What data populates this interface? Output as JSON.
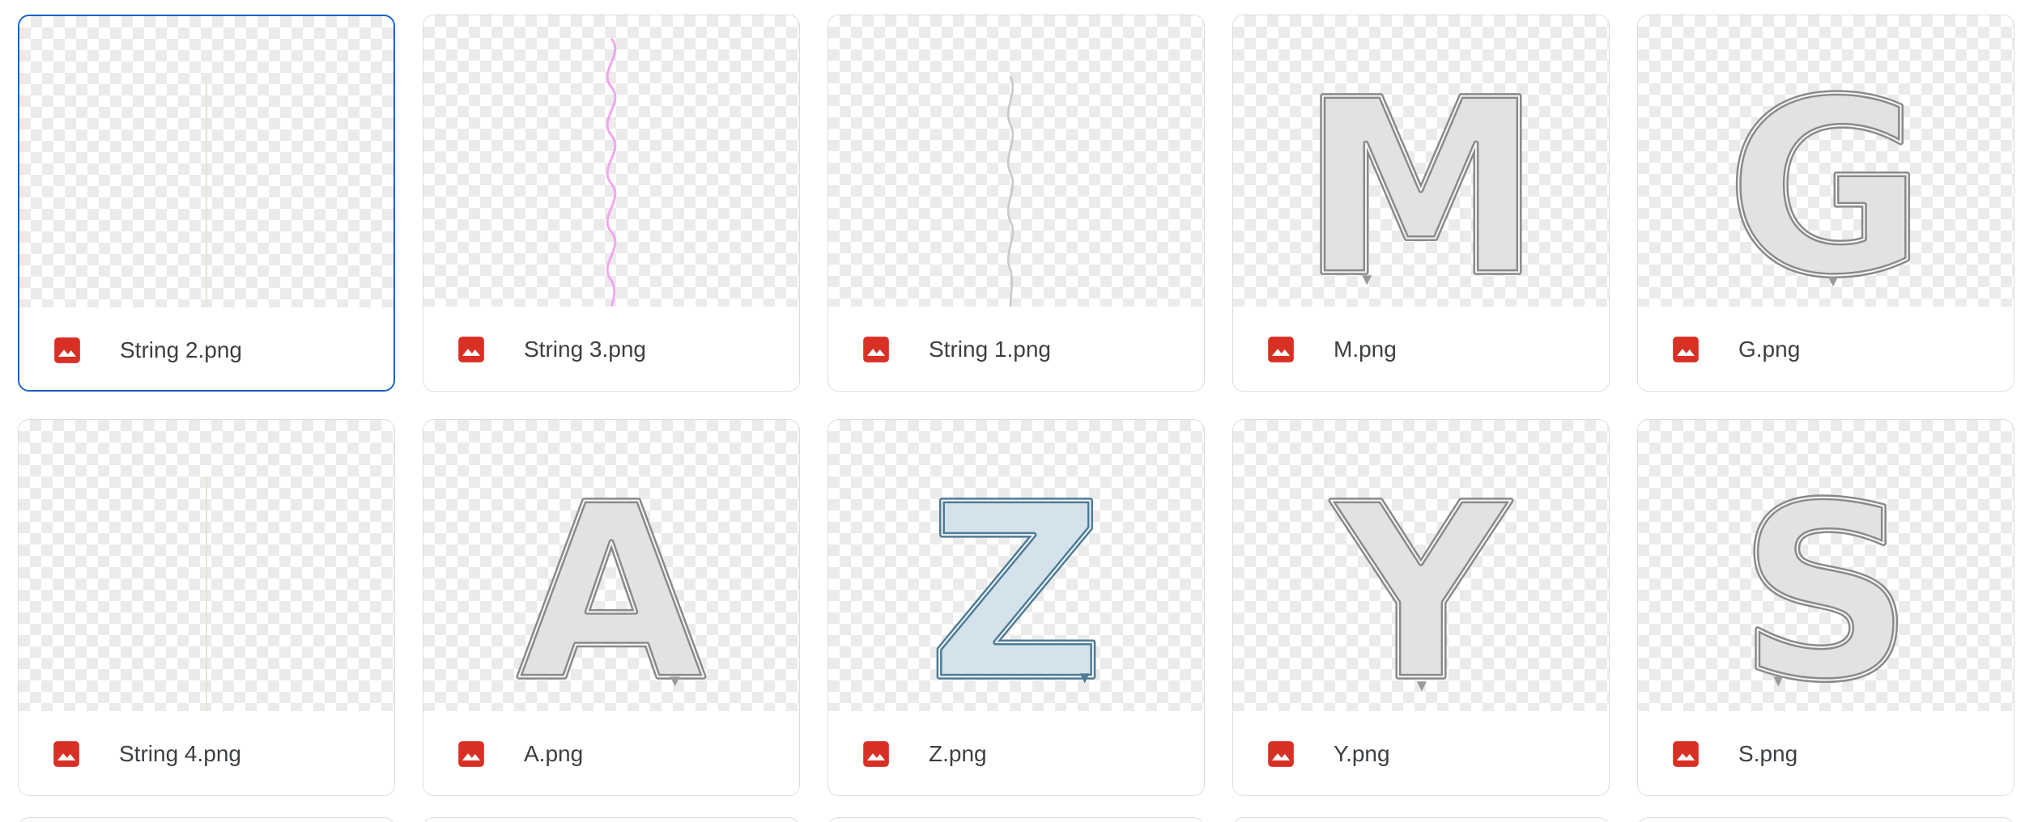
{
  "files": [
    {
      "name": "String 2.png",
      "type_icon": "image-file-icon",
      "thumb": "string-thin-green",
      "selected": true
    },
    {
      "name": "String 3.png",
      "type_icon": "image-file-icon",
      "thumb": "string-wavy-pink",
      "selected": false
    },
    {
      "name": "String 1.png",
      "type_icon": "image-file-icon",
      "thumb": "string-wavy-gray",
      "selected": false
    },
    {
      "name": "M.png",
      "type_icon": "image-file-icon",
      "thumb": "balloon-letter-M",
      "letter": "M",
      "selected": false
    },
    {
      "name": "G.png",
      "type_icon": "image-file-icon",
      "thumb": "balloon-letter-G",
      "letter": "G",
      "selected": false
    },
    {
      "name": "String 4.png",
      "type_icon": "image-file-icon",
      "thumb": "string-thin-green",
      "selected": false
    },
    {
      "name": "A.png",
      "type_icon": "image-file-icon",
      "thumb": "balloon-letter-A",
      "letter": "A",
      "selected": false
    },
    {
      "name": "Z.png",
      "type_icon": "image-file-icon",
      "thumb": "balloon-letter-Z",
      "letter": "Z",
      "selected": false
    },
    {
      "name": "Y.png",
      "type_icon": "image-file-icon",
      "thumb": "balloon-letter-Y",
      "letter": "Y",
      "selected": false
    },
    {
      "name": "S.png",
      "type_icon": "image-file-icon",
      "thumb": "balloon-letter-S",
      "letter": "S",
      "selected": false
    }
  ],
  "colors": {
    "selected_border": "#1a63c7",
    "file_icon_red": "#d93025",
    "string_pink": "#f3a6f0",
    "string_gray": "#c8c8c8",
    "string_green": "#dfe8c8",
    "balloon_silver_fill": "#e2e2e2",
    "balloon_silver_edge": "#8a8a8a",
    "balloon_blue_fill": "#d4e2ec",
    "balloon_blue_edge": "#4f7b96"
  }
}
